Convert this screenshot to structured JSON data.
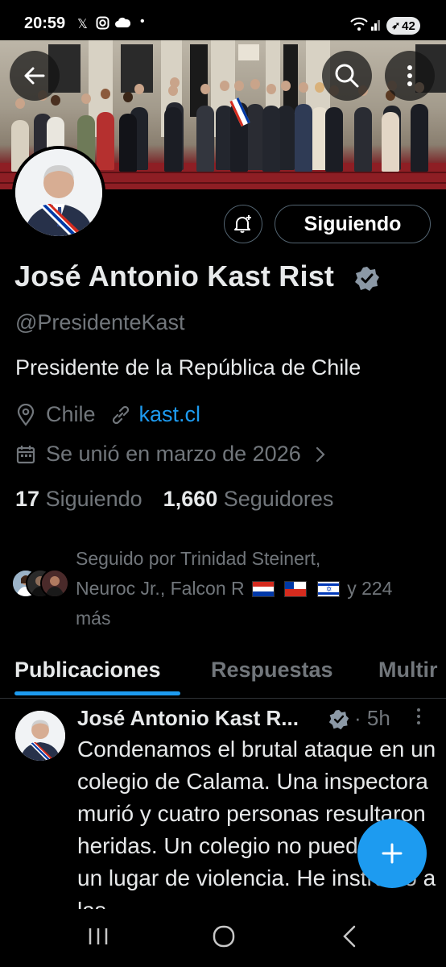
{
  "status_bar": {
    "time": "20:59",
    "battery": "42"
  },
  "profile": {
    "name": "José Antonio Kast Rist",
    "handle": "@PresidenteKast",
    "bio": "Presidente de la República de Chile",
    "location": "Chile",
    "website": "kast.cl",
    "joined": "Se unió en marzo de 2026",
    "following_count": "17",
    "following_label": "Siguiendo",
    "followers_count": "1,660",
    "followers_label": "Seguidores",
    "follow_button_label": "Siguiendo",
    "followed_by_line1": "Seguido por Trinidad Steinert,",
    "followed_by_line2_start": "Neuroc Jr., Falcon R",
    "followed_by_line2_end": "y 224",
    "followed_by_line3": "más"
  },
  "tabs": [
    {
      "label": "Publicaciones",
      "active": true
    },
    {
      "label": "Respuestas",
      "active": false
    },
    {
      "label": "Multir",
      "active": false
    }
  ],
  "post": {
    "author": "José Antonio Kast R...",
    "time": "· 5h",
    "text": "Condenamos el brutal ataque en un colegio de Calama. Una inspectora murió y cuatro personas resultaron heridas. Un colegio no puede ser un lugar de violencia. He instruido a las"
  },
  "icons": {
    "back": "arrow-left-icon",
    "search": "search-icon",
    "more": "more-vertical-icon",
    "bell": "bell-plus-icon",
    "verified": "verified-badge-icon",
    "location": "location-pin-icon",
    "link": "link-icon",
    "calendar": "calendar-icon",
    "compose": "plus-icon"
  },
  "colors": {
    "accent": "#1d9bf0",
    "text": "#e7e9ea",
    "muted": "#71767b",
    "background": "#000000"
  }
}
